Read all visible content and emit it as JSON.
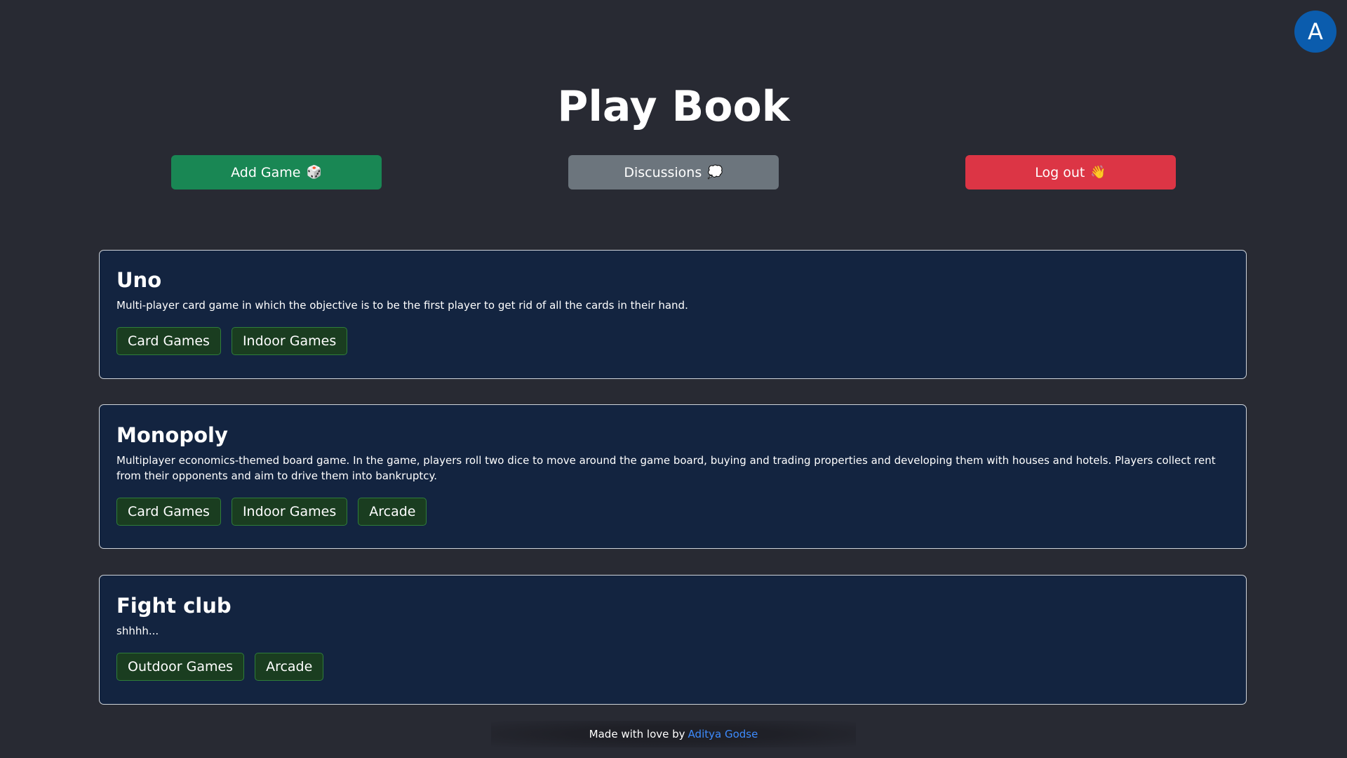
{
  "header": {
    "avatar_initial": "A",
    "title": "Play Book"
  },
  "actions": {
    "add_game_label": "Add Game",
    "add_game_emoji": "🎲",
    "discussions_label": "Discussions",
    "discussions_emoji": "💭",
    "logout_label": "Log out",
    "logout_emoji": "👋"
  },
  "games": [
    {
      "title": "Uno",
      "description": "Multi-player card game in which the objective is to be the first player to get rid of all the cards in their hand.",
      "tags": [
        "Card Games",
        "Indoor Games"
      ]
    },
    {
      "title": "Monopoly",
      "description": "Multiplayer economics-themed board game. In the game, players roll two dice to move around the game board, buying and trading properties and developing them with houses and hotels. Players collect rent from their opponents and aim to drive them into bankruptcy.",
      "tags": [
        "Card Games",
        "Indoor Games",
        "Arcade"
      ]
    },
    {
      "title": "Fight club",
      "description": "shhhh...",
      "tags": [
        "Outdoor Games",
        "Arcade"
      ]
    }
  ],
  "footer": {
    "text": "Made with love by",
    "author": "Aditya Godse"
  },
  "colors": {
    "background": "#282a33",
    "card": "#132440",
    "add_button": "#198754",
    "discussions_button": "#6c757d",
    "logout_button": "#dc3545",
    "avatar": "#0b5cad",
    "link": "#3d8bfd"
  }
}
